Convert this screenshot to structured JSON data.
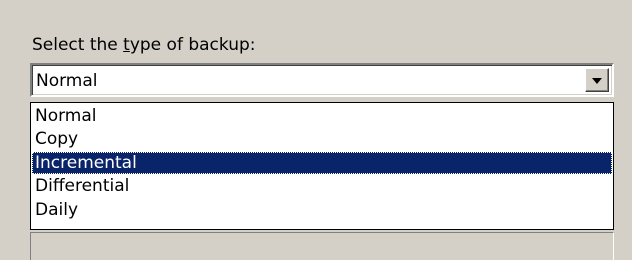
{
  "group": {
    "label_before": "Select the ",
    "label_accel": "t",
    "label_after": "ype of backup:"
  },
  "combo": {
    "value": "Normal"
  },
  "dropdown": {
    "items": [
      "Normal",
      "Copy",
      "Incremental",
      "Differential",
      "Daily"
    ],
    "selected_index": 2
  },
  "colors": {
    "face": "#d4d0c8",
    "highlight": "#0a246a",
    "highlight_text": "#ffffff",
    "field": "#ffffff"
  },
  "icons": {
    "combo_button": "chevron-down-icon"
  }
}
